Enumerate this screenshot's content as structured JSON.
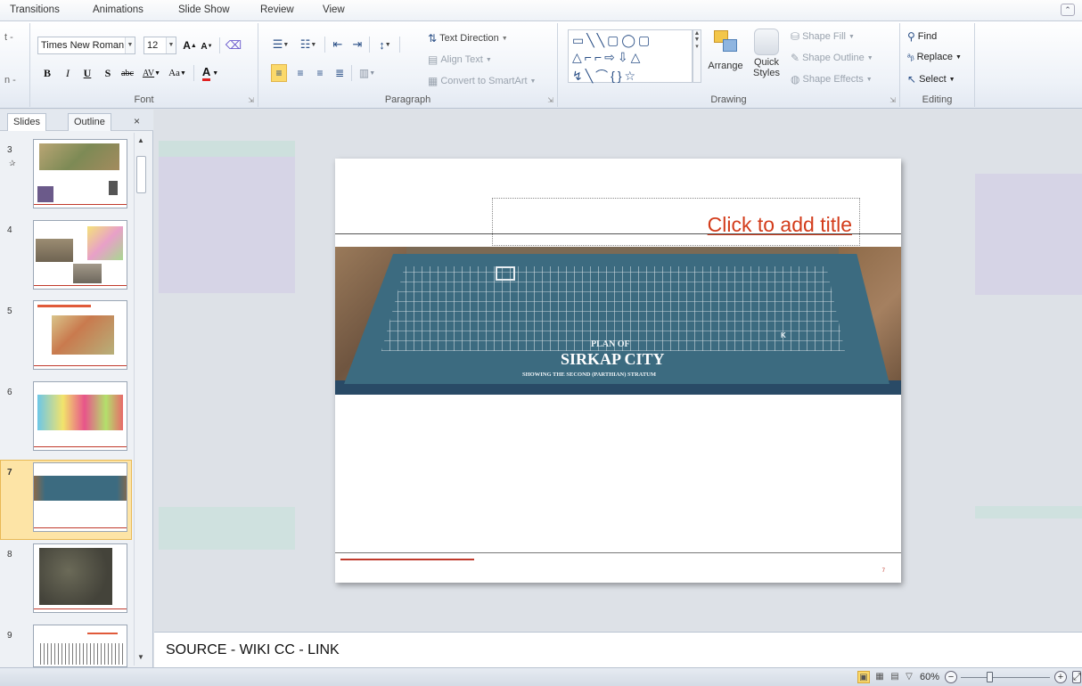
{
  "ribbon_tabs": [
    "Transitions",
    "Animations",
    "Slide Show",
    "Review",
    "View"
  ],
  "font": {
    "family": "Times New Roman",
    "size": "12",
    "bold": "B",
    "italic": "I",
    "underline": "U",
    "shadow": "S",
    "strike": "abc",
    "spacing": "AV",
    "case": "Aa",
    "grow": "A",
    "shrink": "A",
    "color_glyph": "A",
    "group_label": "Font"
  },
  "paragraph": {
    "text_direction": "Text Direction",
    "align_text": "Align Text",
    "convert_smartart": "Convert to SmartArt",
    "group_label": "Paragraph"
  },
  "drawing": {
    "shape_rows": [
      "▭╲╲▢◯▢",
      "△⌐⌐⇨⇩△",
      "↯╲⌒{}☆"
    ],
    "arrange": "Arrange",
    "quick_styles_1": "Quick",
    "quick_styles_2": "Styles",
    "shape_fill": "Shape Fill",
    "shape_outline": "Shape Outline",
    "shape_effects": "Shape Effects",
    "group_label": "Drawing"
  },
  "editing": {
    "find": "Find",
    "replace": "Replace",
    "select": "Select",
    "group_label": "Editing"
  },
  "partial_left": {
    "top": "t -",
    "bottom": "n -"
  },
  "panel": {
    "tabs": [
      "Slides",
      "Outline"
    ],
    "close": "×",
    "slide_numbers": [
      "3",
      "4",
      "5",
      "6",
      "7",
      "8",
      "9"
    ],
    "selected_slide": "7"
  },
  "slide": {
    "title_placeholder": "Click to add title",
    "photo_line1": "PLAN OF",
    "photo_line2": "SIRKAP CITY",
    "photo_line3": "SHOWING THE SECOND (PARTHIAN) STRATUM",
    "photo_k": "K",
    "page_number": "7"
  },
  "notes": {
    "text": "SOURCE - WIKI CC - LINK"
  },
  "status": {
    "zoom": "60%",
    "zoom_fraction": 0.33
  },
  "colors": {
    "title_red": "#d33c1b",
    "selection": "#fbd96a",
    "board_teal": "#3c6b80"
  }
}
